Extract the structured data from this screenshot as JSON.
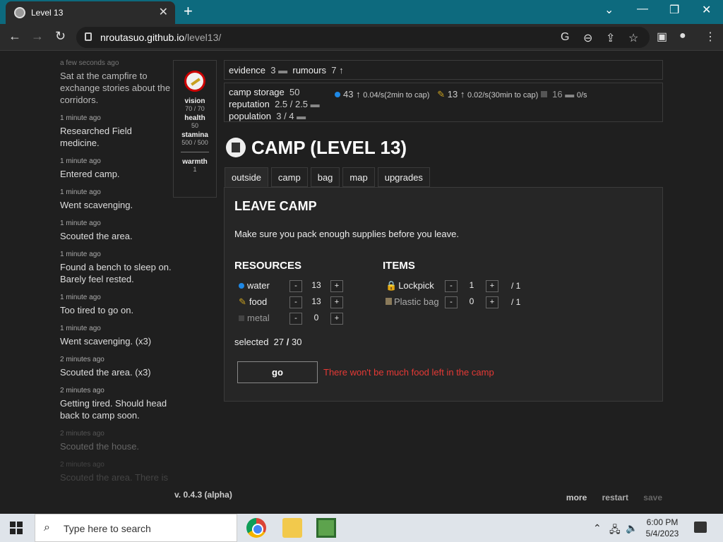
{
  "browser": {
    "tab_title": "Level 13",
    "url_host": "nroutasuo.github.io",
    "url_path": "/level13/"
  },
  "log": [
    {
      "time": "a few seconds ago",
      "msg": "Sat at the campfire to exchange stories about the corridors."
    },
    {
      "time": "1 minute ago",
      "msg": "Researched Field medicine."
    },
    {
      "time": "1 minute ago",
      "msg": "Entered camp."
    },
    {
      "time": "1 minute ago",
      "msg": "Went scavenging."
    },
    {
      "time": "1 minute ago",
      "msg": "Scouted the area."
    },
    {
      "time": "1 minute ago",
      "msg": "Found a bench to sleep on. Barely feel rested."
    },
    {
      "time": "1 minute ago",
      "msg": "Too tired to go on."
    },
    {
      "time": "1 minute ago",
      "msg": "Went scavenging. (x3)"
    },
    {
      "time": "2 minutes ago",
      "msg": "Scouted the area. (x3)"
    },
    {
      "time": "2 minutes ago",
      "msg": "Getting tired. Should head back to camp soon."
    },
    {
      "time": "2 minutes ago",
      "msg": "Scouted the house."
    },
    {
      "time": "2 minutes ago",
      "msg": "Scouted the area. There is"
    }
  ],
  "stats": {
    "vision_label": "vision",
    "vision_value": "70 / 70",
    "health_label": "health",
    "health_value": "50",
    "stamina_label": "stamina",
    "stamina_value": "500 / 500",
    "warmth_label": "warmth",
    "warmth_value": "1"
  },
  "topbar": {
    "evidence_label": "evidence",
    "evidence_value": "3",
    "rumours_label": "rumours",
    "rumours_value": "7"
  },
  "camp_info": {
    "storage_label": "camp storage",
    "storage_value": "50",
    "reputation_label": "reputation",
    "reputation_value": "2.5 / 2.5",
    "population_label": "population",
    "population_value": "3 / 4"
  },
  "resources_bar": [
    {
      "name": "water",
      "value": "43",
      "rate": "0.04/s(2min to cap)",
      "color": "#1e88e5"
    },
    {
      "name": "food",
      "value": "13",
      "rate": "0.02/s(30min to cap)",
      "color": "#c8a020"
    },
    {
      "name": "metal",
      "value": "16",
      "rate": "0/s",
      "color": "#555555"
    }
  ],
  "heading": "CAMP (LEVEL 13)",
  "tabs": [
    "outside",
    "camp",
    "bag",
    "map",
    "upgrades"
  ],
  "panel": {
    "title": "LEAVE CAMP",
    "note": "Make sure you pack enough supplies before you leave.",
    "resources_title": "RESOURCES",
    "items_title": "ITEMS",
    "resources": [
      {
        "name": "water",
        "qty": "13"
      },
      {
        "name": "food",
        "qty": "13"
      },
      {
        "name": "metal",
        "qty": "0"
      }
    ],
    "items": [
      {
        "name": "Lockpick",
        "qty": "1",
        "max": "/ 1"
      },
      {
        "name": "Plastic bag",
        "qty": "0",
        "max": "/ 1"
      }
    ],
    "minus": "-",
    "plus": "+",
    "selected_label": "selected",
    "selected_value": "27",
    "selected_sep": "/",
    "selected_max": "30",
    "go": "go",
    "warning": "There won't be much food left in the camp"
  },
  "footer": {
    "version": "v. 0.4.3 (alpha)",
    "more": "more",
    "restart": "restart",
    "save": "save"
  },
  "taskbar": {
    "search_placeholder": "Type here to search",
    "time": "6:00 PM",
    "date": "5/4/2023"
  }
}
